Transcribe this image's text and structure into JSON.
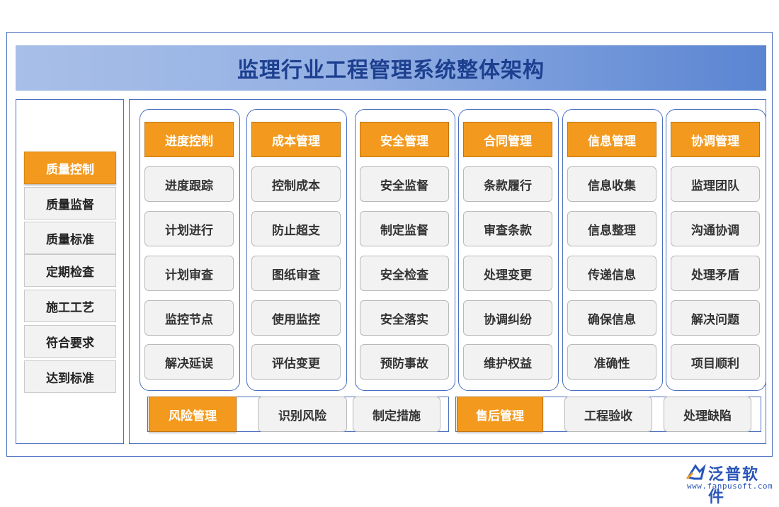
{
  "title": "监理行业工程管理系统整体架构",
  "side_menu": [
    {
      "label": "质量控制",
      "active": true
    },
    {
      "label": "质量监督",
      "active": false
    },
    {
      "label": "质量标准",
      "active": false
    },
    {
      "label": "定期检查",
      "active": false
    },
    {
      "label": "施工工艺",
      "active": false
    },
    {
      "label": "符合要求",
      "active": false
    },
    {
      "label": "达到标准",
      "active": false
    }
  ],
  "modules": [
    {
      "title": "进度控制",
      "items": [
        "进度跟踪",
        "计划进行",
        "计划审查",
        "监控节点",
        "解决延误"
      ]
    },
    {
      "title": "成本管理",
      "items": [
        "控制成本",
        "防止超支",
        "图纸审查",
        "使用监控",
        "评估变更"
      ]
    },
    {
      "title": "安全管理",
      "items": [
        "安全监督",
        "制定监督",
        "安全检查",
        "安全落实",
        "预防事故"
      ]
    },
    {
      "title": "合同管理",
      "items": [
        "条款履行",
        "审查条款",
        "处理变更",
        "协调纠纷",
        "维护权益"
      ]
    },
    {
      "title": "信息管理",
      "items": [
        "信息收集",
        "信息整理",
        "传递信息",
        "确保信息",
        "准确性"
      ]
    },
    {
      "title": "协调管理",
      "items": [
        "监理团队",
        "沟通协调",
        "处理矛盾",
        "解决问题",
        "项目顺利"
      ]
    }
  ],
  "bottom_groups": [
    {
      "title": "风险管理",
      "items": [
        "识别风险",
        "制定措施"
      ]
    },
    {
      "title": "售后管理",
      "items": [
        "工程验收",
        "处理缺陷"
      ]
    }
  ],
  "logo": {
    "name": "泛普软件",
    "url": "www.fanpusoft.com"
  },
  "colors": {
    "accent": "#f39a1e",
    "border": "#4a6fc0",
    "title": "#1d3f8f"
  }
}
